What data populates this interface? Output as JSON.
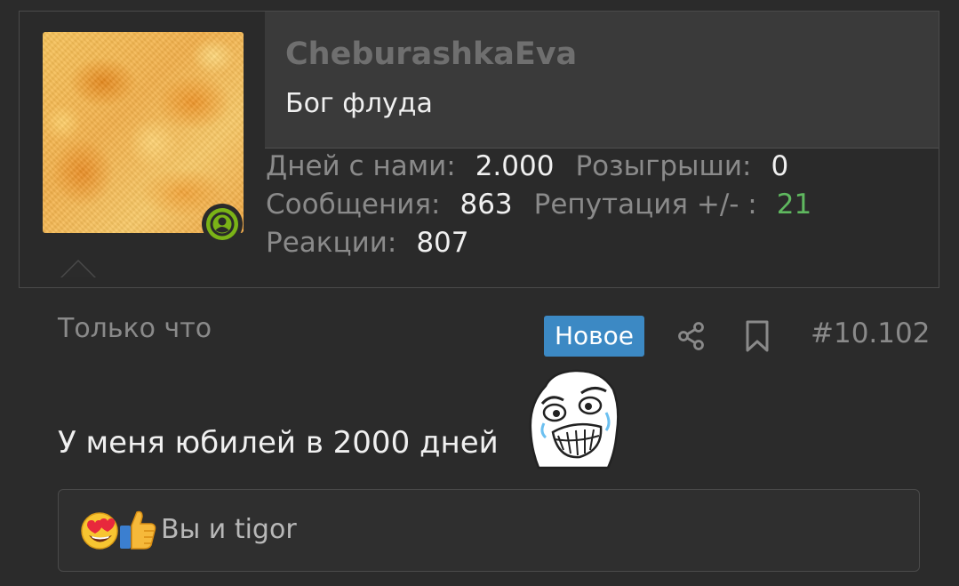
{
  "user": {
    "username": "CheburashkaEva",
    "title": "Бог флуда",
    "status": "online",
    "stats": {
      "days_label": "Дней с нами:",
      "days_value": "2.000",
      "giveaways_label": "Розыгрыши:",
      "giveaways_value": "0",
      "messages_label": "Сообщения:",
      "messages_value": "863",
      "reputation_label": "Репутация +/- :",
      "reputation_value": "21",
      "reactions_label": "Реакции:",
      "reactions_value": "807"
    }
  },
  "post": {
    "time": "Только что",
    "new_badge": "Новое",
    "number": "#10.102",
    "text": "У меня юбилей в 2000 дней",
    "inline_image": "rage-face-troll-happy"
  },
  "reactions": {
    "icons": [
      "heart-eyes-emoji",
      "thumbs-up-emoji"
    ],
    "text": "Вы и tigor"
  },
  "colors": {
    "background": "#2b2b2b",
    "header_panel": "#3a3a3a",
    "accent_badge": "#3c89c4",
    "online": "#7ab317",
    "reputation_positive": "#5fb85f"
  }
}
